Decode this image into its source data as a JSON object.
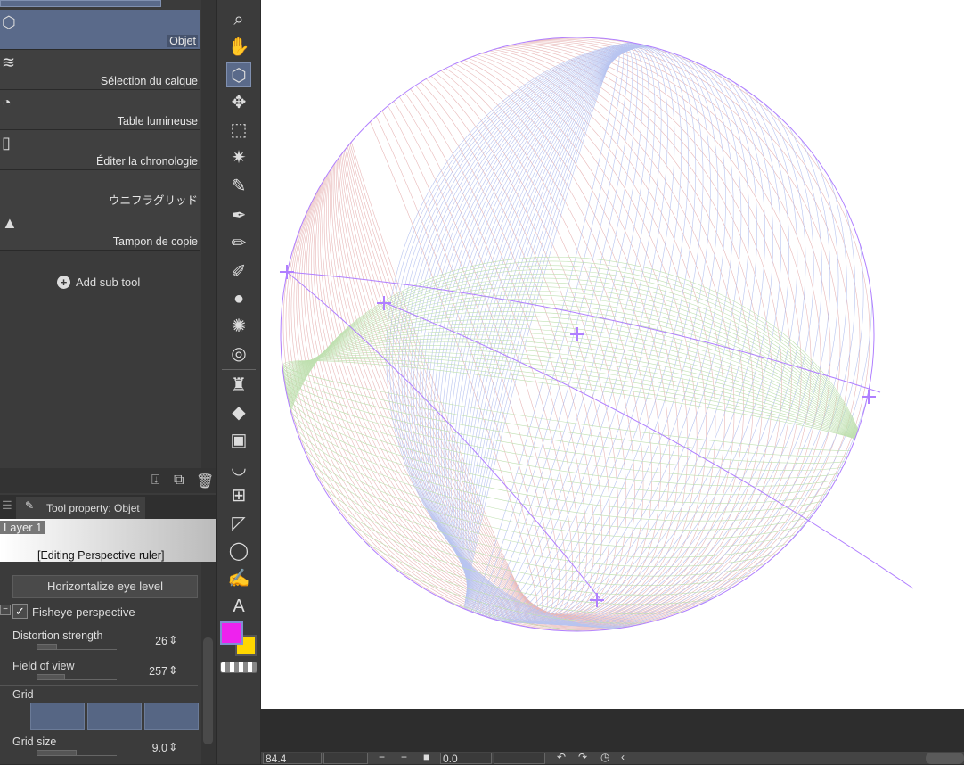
{
  "subtools": [
    {
      "label": "Objet",
      "icon": "object-select-icon",
      "selected": true
    },
    {
      "label": "Sélection du calque",
      "icon": "layer-select-icon"
    },
    {
      "label": "Table lumineuse",
      "icon": "light-table-icon"
    },
    {
      "label": "Éditer la chronologie",
      "icon": "timeline-icon"
    },
    {
      "label": "ウニフラグリッド",
      "icon": "focus-lines-icon"
    },
    {
      "label": "Tampon de copie",
      "icon": "stamp-icon"
    }
  ],
  "add_sub_tool": "Add sub tool",
  "tool_property": {
    "tab": "Tool property: Objet",
    "layer": "Layer 1",
    "editing": "[Editing Perspective ruler]",
    "horizontalize": "Horizontalize eye level",
    "fisheye": {
      "label": "Fisheye perspective",
      "checked": true
    },
    "distortion": {
      "label": "Distortion strength",
      "value": "26",
      "fraction": 0.26
    },
    "fov": {
      "label": "Field of view",
      "value": "257",
      "fraction": 0.36
    },
    "grid": "Grid",
    "grid_size": {
      "label": "Grid size",
      "value": "9.0",
      "fraction": 0.5
    }
  },
  "colors": {
    "main": "#ee22ee",
    "sub": "#ffd700",
    "accent": "#5a6a8a",
    "ruler": "#b07fff",
    "grid_pink": "#e8b8b8",
    "grid_blue": "#b8c4f0",
    "grid_green": "#bfe0b0"
  },
  "bottom": {
    "zoom": "84.4",
    "angle": "0.0"
  }
}
